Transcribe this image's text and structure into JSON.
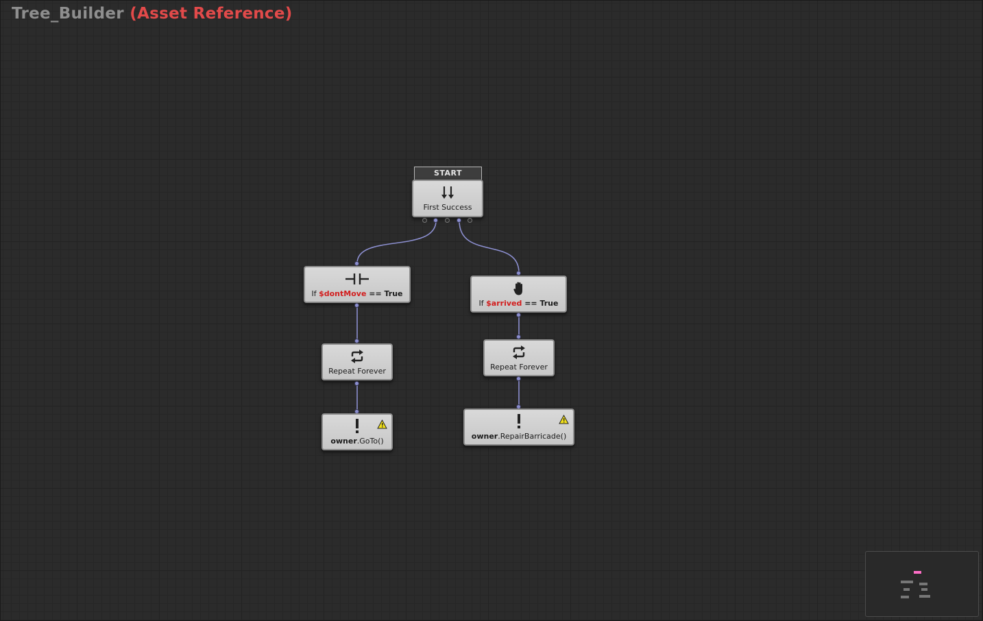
{
  "header": {
    "tree_name": "Tree_Builder",
    "asset_ref": "(Asset Reference)"
  },
  "start_label": "START",
  "nodes": {
    "root": {
      "label": "First Success",
      "icon": "first-success-icon"
    },
    "left_condition": {
      "prefix": "If ",
      "variable": "$dontMove",
      "operator": " == ",
      "value": "True",
      "icon": "condition-pause-icon"
    },
    "right_condition": {
      "prefix": "If ",
      "variable": "$arrived",
      "operator": " == ",
      "value": "True",
      "icon": "hand-icon"
    },
    "left_repeat": {
      "label": "Repeat Forever",
      "icon": "repeat-icon"
    },
    "right_repeat": {
      "label": "Repeat Forever",
      "icon": "repeat-icon"
    },
    "left_action": {
      "owner": "owner",
      "method": ".GoTo()",
      "icon": "exclamation-icon",
      "status": "warning"
    },
    "right_action": {
      "owner": "owner",
      "method": ".RepairBarricade()",
      "icon": "exclamation-icon",
      "status": "warning"
    }
  },
  "colors": {
    "accent_red": "#e24a4a",
    "link": "#8c8fd0",
    "node_bg": "#d0d0d0",
    "canvas": "#2b2b2b",
    "warning": "#f2e01a",
    "minimap_marker": "#ff6ec7"
  }
}
